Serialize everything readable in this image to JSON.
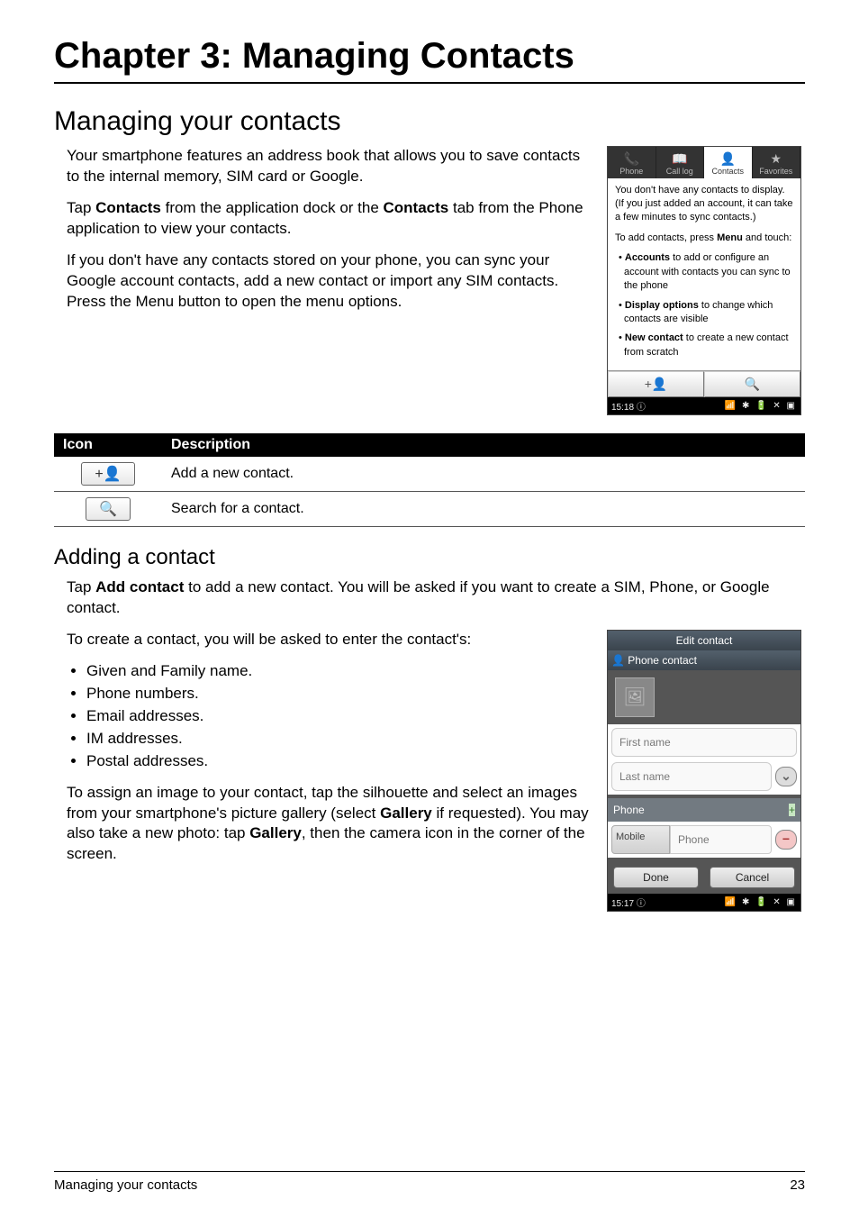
{
  "chapter": {
    "title": "Chapter 3: Managing Contacts"
  },
  "section": {
    "title": "Managing your contacts"
  },
  "intro": {
    "p1": "Your smartphone features an address book that allows you to save contacts to the internal memory, SIM card or Google.",
    "p2a": "Tap ",
    "p2b": "Contacts",
    "p2c": " from the application dock or the ",
    "p2d": "Contacts",
    "p2e": " tab from the Phone application to view your contacts.",
    "p3": "If you don't have any contacts stored on your phone, you can sync your Google account contacts, add a new contact or import any SIM contacts. Press the Menu button to open the menu options."
  },
  "shot1": {
    "tabs": {
      "phone": "Phone",
      "calllog": "Call log",
      "contacts": "Contacts",
      "favorites": "Favorites"
    },
    "body": {
      "p1": "You don't have any contacts to display. (If you just added an account, it can take a few minutes to sync contacts.)",
      "p2a": "To add contacts, press ",
      "p2b": "Menu",
      "p2c": " and touch:",
      "li1a": "Accounts",
      "li1b": " to add or configure an account with contacts you can sync to the phone",
      "li2a": "Display options",
      "li2b": " to change which contacts are visible",
      "li3a": "New contact",
      "li3b": " to create a new contact from scratch"
    },
    "add_icon_glyph": "+👤",
    "search_icon_glyph": "🔍",
    "time": "15:18",
    "status_icons": "ⓘ        📶 ✱ 🔋 ✕ ▣"
  },
  "iconTable": {
    "headers": {
      "icon": "Icon",
      "desc": "Description"
    },
    "rows": [
      {
        "glyph": "+👤",
        "desc": "Add a new contact."
      },
      {
        "glyph": "🔍",
        "desc": "Search for a contact."
      }
    ]
  },
  "subsection": {
    "title": "Adding a contact"
  },
  "adding": {
    "p1a": "Tap ",
    "p1b": "Add contact",
    "p1c": " to add a new contact. You will be asked if you want to create a SIM, Phone, or Google contact.",
    "p2": "To create a contact, you will be asked to enter the contact's:",
    "bullets": [
      "Given and Family name.",
      "Phone numbers.",
      "Email addresses.",
      "IM addresses.",
      "Postal addresses."
    ],
    "p3a": "To assign an image to your contact, tap the silhouette and select an images from your smartphone's picture gallery (select ",
    "p3b": "Gallery",
    "p3c": " if requested). You may also take a new photo: tap ",
    "p3d": "Gallery",
    "p3e": ", then the camera icon in the corner of the screen."
  },
  "shot2": {
    "title": "Edit contact",
    "subtitle": "Phone contact",
    "firstname_placeholder": "First name",
    "lastname_placeholder": "Last name",
    "phone_section": "Phone",
    "mobile_label": "Mobile",
    "phone_placeholder": "Phone",
    "done": "Done",
    "cancel": "Cancel",
    "time": "15:17",
    "status_icons": "ⓘ            📶 ✱ 🔋 ✕ ▣"
  },
  "footer": {
    "title": "Managing your contacts",
    "page": "23"
  }
}
